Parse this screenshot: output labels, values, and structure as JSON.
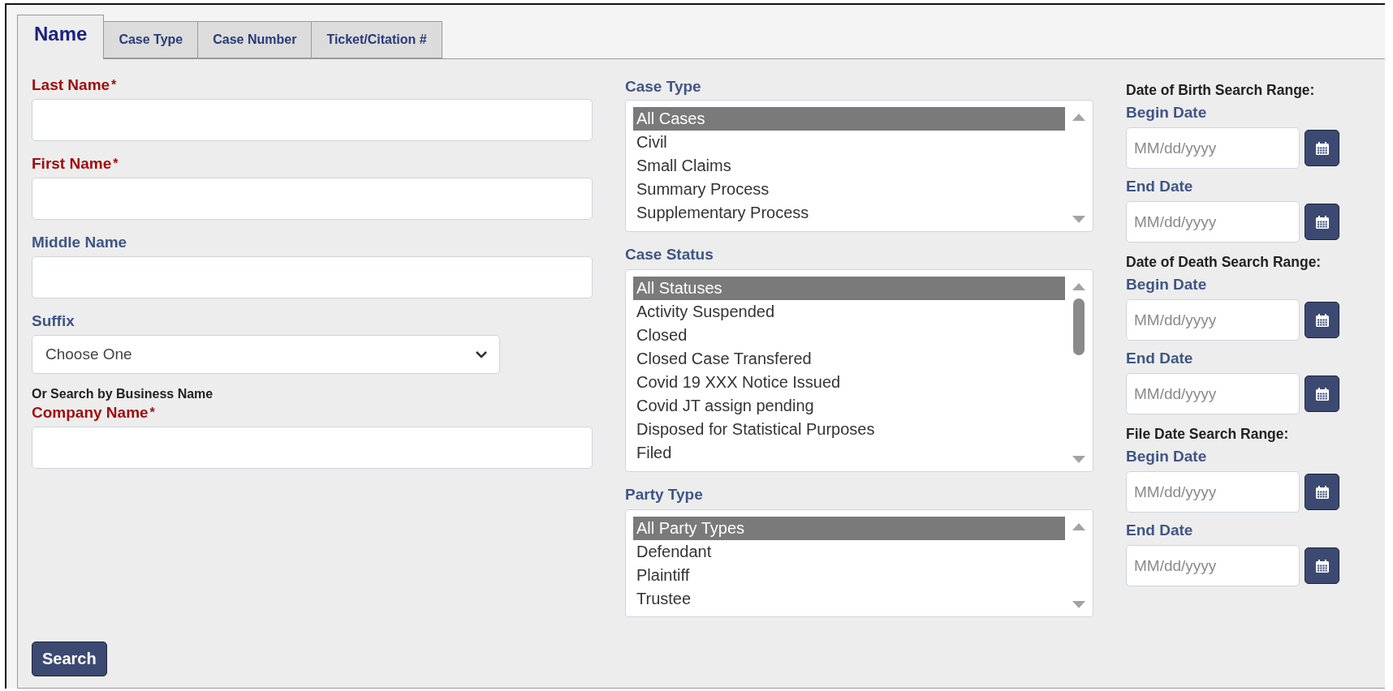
{
  "tabs": [
    {
      "label": "Name",
      "selected": true
    },
    {
      "label": "Case Type",
      "selected": false
    },
    {
      "label": "Case Number",
      "selected": false
    },
    {
      "label": "Ticket/Citation #",
      "selected": false
    }
  ],
  "name_fields": [
    {
      "kind": "text",
      "label": "Last Name",
      "required_mark": "*"
    },
    {
      "kind": "text",
      "label": "First Name",
      "required_mark": "*"
    },
    {
      "kind": "text",
      "label": "Middle Name"
    },
    {
      "kind": "select",
      "label": "Suffix",
      "value": "Choose One"
    },
    {
      "kind": "note",
      "label": "Or Search by Business Name"
    },
    {
      "kind": "text",
      "label": "Company Name",
      "required_mark": "*"
    }
  ],
  "lists": [
    {
      "label": "Case Type",
      "items": [
        {
          "label": "All Cases",
          "selected": true
        },
        {
          "label": "Civil",
          "selected": false
        },
        {
          "label": "Small Claims",
          "selected": false
        },
        {
          "label": "Summary Process",
          "selected": false
        },
        {
          "label": "Supplementary Process",
          "selected": false
        }
      ]
    },
    {
      "label": "Case Status",
      "items": [
        {
          "label": "All Statuses",
          "selected": true
        },
        {
          "label": "Activity Suspended",
          "selected": false
        },
        {
          "label": "Closed",
          "selected": false
        },
        {
          "label": "Closed Case Transfered",
          "selected": false
        },
        {
          "label": "Covid 19 XXX Notice Issued",
          "selected": false
        },
        {
          "label": "Covid JT assign pending",
          "selected": false
        },
        {
          "label": "Disposed for Statistical Purposes",
          "selected": false
        },
        {
          "label": "Filed",
          "selected": false
        }
      ]
    },
    {
      "label": "Party Type",
      "items": [
        {
          "label": "All Party Types",
          "selected": true
        },
        {
          "label": "Defendant",
          "selected": false
        },
        {
          "label": "Plaintiff",
          "selected": false
        },
        {
          "label": "Trustee",
          "selected": false
        }
      ]
    }
  ],
  "date_ranges": [
    {
      "heading": "Date of Birth Search Range:",
      "fields": [
        {
          "label": "Begin Date",
          "placeholder": "MM/dd/yyyy"
        },
        {
          "label": "End Date",
          "placeholder": "MM/dd/yyyy"
        }
      ]
    },
    {
      "heading": "Date of Death Search Range:",
      "fields": [
        {
          "label": "Begin Date",
          "placeholder": "MM/dd/yyyy"
        },
        {
          "label": "End Date",
          "placeholder": "MM/dd/yyyy"
        }
      ]
    },
    {
      "heading": "File Date Search Range:",
      "fields": [
        {
          "label": "Begin Date",
          "placeholder": "MM/dd/yyyy"
        },
        {
          "label": "End Date",
          "placeholder": "MM/dd/yyyy"
        }
      ]
    }
  ],
  "search_button": "Search"
}
